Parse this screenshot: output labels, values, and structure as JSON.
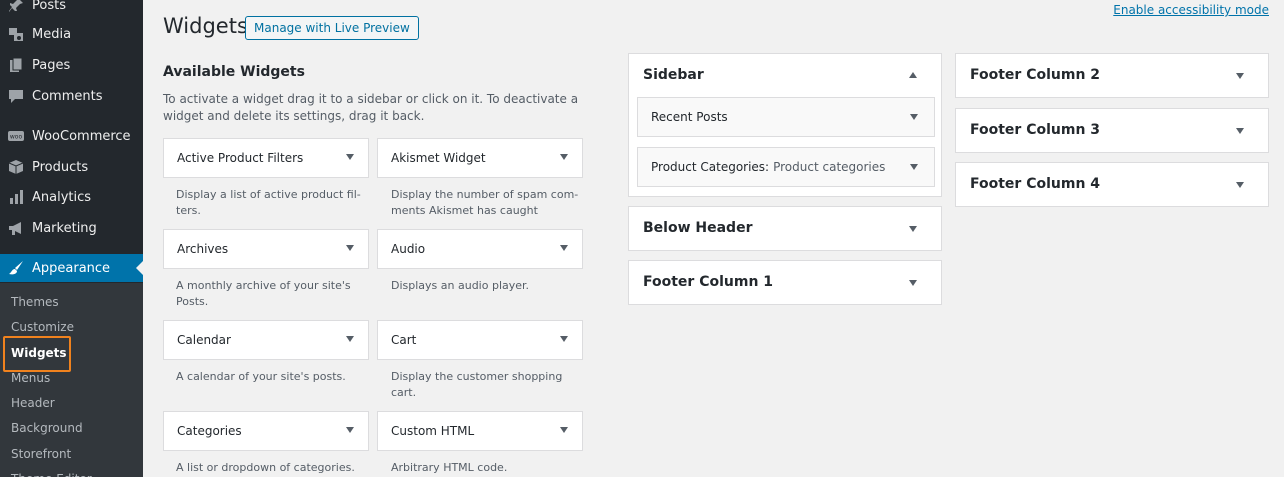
{
  "admin_menu": {
    "items": [
      {
        "label": "Posts",
        "icon": "pin-icon"
      },
      {
        "label": "Media",
        "icon": "media-icon"
      },
      {
        "label": "Pages",
        "icon": "pages-icon"
      },
      {
        "label": "Comments",
        "icon": "comment-icon"
      },
      {
        "label": "WooCommerce",
        "icon": "woocommerce-icon"
      },
      {
        "label": "Products",
        "icon": "box-icon"
      },
      {
        "label": "Analytics",
        "icon": "bar-chart-icon"
      },
      {
        "label": "Marketing",
        "icon": "megaphone-icon"
      },
      {
        "label": "Appearance",
        "icon": "brush-icon"
      }
    ],
    "submenu": [
      "Themes",
      "Customize",
      "Widgets",
      "Menus",
      "Header",
      "Background",
      "Storefront",
      "Theme Editor"
    ],
    "active_submenu": "Widgets"
  },
  "header": {
    "title": "Widgets",
    "live_preview_button": "Manage with Live Preview",
    "accessibility_link": "Enable accessibility mode"
  },
  "available": {
    "title": "Available Widgets",
    "description": "To activate a widget drag it to a sidebar or click on it. To deactivate a widget and delete its settings, drag it back.",
    "widgets": [
      {
        "name": "Active Product Filters",
        "desc": "Display a list of active product fil-ters."
      },
      {
        "name": "Akismet Widget",
        "desc": "Display the number of spam com-ments Akismet has caught"
      },
      {
        "name": "Archives",
        "desc": "A monthly archive of your site's Posts."
      },
      {
        "name": "Audio",
        "desc": "Displays an audio player."
      },
      {
        "name": "Calendar",
        "desc": "A calendar of your site's posts."
      },
      {
        "name": "Cart",
        "desc": "Display the customer shopping cart."
      },
      {
        "name": "Categories",
        "desc": "A list or dropdown of categories."
      },
      {
        "name": "Custom HTML",
        "desc": "Arbitrary HTML code."
      }
    ]
  },
  "sidebars": {
    "sidebar": {
      "title": "Sidebar",
      "widgets": [
        {
          "name": "Recent Posts",
          "sub": ""
        },
        {
          "name": "Product Categories:",
          "sub": "Product categories"
        }
      ]
    },
    "below_header": {
      "title": "Below Header"
    },
    "footer_1": {
      "title": "Footer Column 1"
    },
    "footer_2": {
      "title": "Footer Column 2"
    },
    "footer_3": {
      "title": "Footer Column 3"
    },
    "footer_4": {
      "title": "Footer Column 4"
    }
  },
  "colors": {
    "admin_bg": "#23282d",
    "accent": "#0073aa",
    "highlight": "#f0821e"
  }
}
